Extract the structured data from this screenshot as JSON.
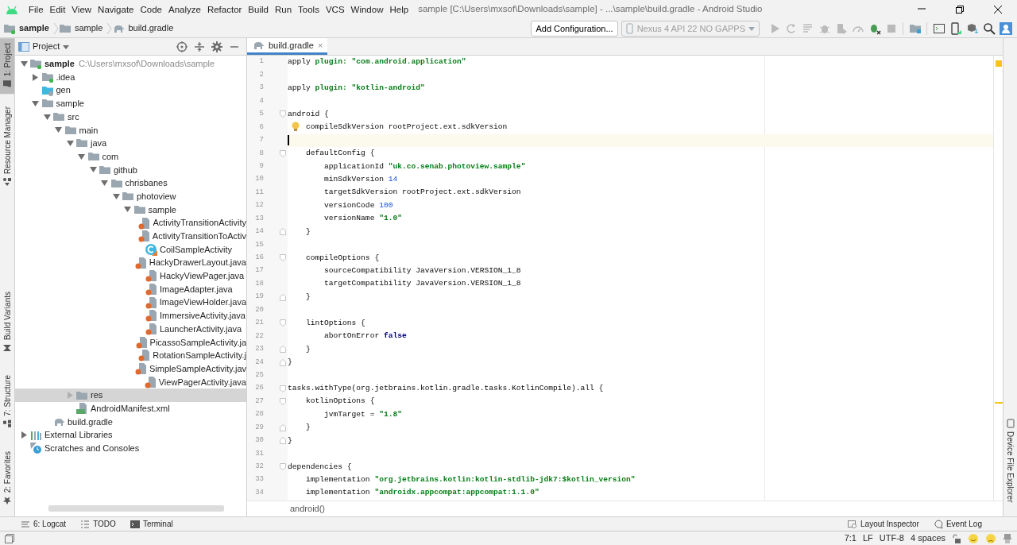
{
  "window": {
    "title": "sample [C:\\Users\\mxsof\\Downloads\\sample] - ...\\sample\\build.gradle - Android Studio"
  },
  "menu": [
    "File",
    "Edit",
    "View",
    "Navigate",
    "Code",
    "Analyze",
    "Refactor",
    "Build",
    "Run",
    "Tools",
    "VCS",
    "Window",
    "Help"
  ],
  "breadcrumbs": [
    {
      "label": "sample",
      "kind": "project"
    },
    {
      "label": "sample",
      "kind": "folder"
    },
    {
      "label": "build.gradle",
      "kind": "gradle"
    }
  ],
  "run_config": {
    "label": "Add Configuration..."
  },
  "device": {
    "label": "Nexus 4 API 22 NO GAPPS",
    "disabled": true
  },
  "toolbar_buttons": [
    {
      "kind": "run",
      "disabled": true
    },
    {
      "kind": "apply-changes",
      "disabled": true
    },
    {
      "kind": "apply-code",
      "disabled": true
    },
    {
      "kind": "debug",
      "disabled": true
    },
    {
      "kind": "profile",
      "disabled": true
    },
    {
      "kind": "attach",
      "disabled": true
    },
    {
      "kind": "sync",
      "disabled": false
    },
    {
      "kind": "stop",
      "disabled": true
    },
    {
      "kind": "project-structure",
      "disabled": false
    },
    {
      "kind": "avd",
      "disabled": false
    },
    {
      "kind": "device",
      "disabled": false
    },
    {
      "kind": "sdk",
      "disabled": false
    },
    {
      "kind": "search",
      "disabled": false
    },
    {
      "kind": "account",
      "disabled": false
    }
  ],
  "left_stripe": {
    "top": [
      {
        "label": "1: Project",
        "kind": "folder",
        "selected": true
      },
      {
        "label": "Resource Manager",
        "kind": "resources",
        "selected": false
      }
    ],
    "bottom": [
      {
        "label": "Build Variants",
        "kind": "variants",
        "selected": false
      },
      {
        "label": "7: Structure",
        "kind": "structure",
        "selected": false
      },
      {
        "label": "2: Favorites",
        "kind": "star",
        "selected": false
      }
    ]
  },
  "project_panel": {
    "view": "Project"
  },
  "tree": [
    {
      "label": "sample",
      "kind": "module-folder",
      "bold": true,
      "hint": "C:\\Users\\mxsof\\Downloads\\sample",
      "expanded": true,
      "selected": false,
      "children": [
        {
          "label": ".idea",
          "kind": "module-folder",
          "expanded": false,
          "selected": false
        },
        {
          "label": "gen",
          "kind": "generated-folder",
          "selected": false
        },
        {
          "label": "sample",
          "kind": "folder",
          "expanded": true,
          "selected": false,
          "children": [
            {
              "label": "src",
              "kind": "folder",
              "expanded": true,
              "selected": false,
              "children": [
                {
                  "label": "main",
                  "kind": "folder",
                  "expanded": true,
                  "selected": false,
                  "children": [
                    {
                      "label": "java",
                      "kind": "folder",
                      "expanded": true,
                      "selected": false,
                      "children": [
                        {
                          "label": "com",
                          "kind": "folder",
                          "expanded": true,
                          "selected": false,
                          "children": [
                            {
                              "label": "github",
                              "kind": "folder",
                              "expanded": true,
                              "selected": false,
                              "children": [
                                {
                                  "label": "chrisbanes",
                                  "kind": "folder",
                                  "expanded": true,
                                  "selected": false,
                                  "children": [
                                    {
                                      "label": "photoview",
                                      "kind": "folder",
                                      "expanded": true,
                                      "selected": false,
                                      "children": [
                                        {
                                          "label": "sample",
                                          "kind": "folder",
                                          "expanded": true,
                                          "selected": false,
                                          "children": [
                                            {
                                              "label": "ActivityTransitionActivity",
                                              "kind": "java",
                                              "selected": false
                                            },
                                            {
                                              "label": "ActivityTransitionToActiv",
                                              "kind": "java",
                                              "selected": false
                                            },
                                            {
                                              "label": "CoilSampleActivity",
                                              "kind": "kotlin-class",
                                              "selected": false
                                            },
                                            {
                                              "label": "HackyDrawerLayout.java",
                                              "kind": "java",
                                              "selected": false
                                            },
                                            {
                                              "label": "HackyViewPager.java",
                                              "kind": "java",
                                              "selected": false
                                            },
                                            {
                                              "label": "ImageAdapter.java",
                                              "kind": "java",
                                              "selected": false
                                            },
                                            {
                                              "label": "ImageViewHolder.java",
                                              "kind": "java",
                                              "selected": false
                                            },
                                            {
                                              "label": "ImmersiveActivity.java",
                                              "kind": "java",
                                              "selected": false
                                            },
                                            {
                                              "label": "LauncherActivity.java",
                                              "kind": "java",
                                              "selected": false
                                            },
                                            {
                                              "label": "PicassoSampleActivity.ja",
                                              "kind": "java",
                                              "selected": false
                                            },
                                            {
                                              "label": "RotationSampleActivity.j",
                                              "kind": "java",
                                              "selected": false
                                            },
                                            {
                                              "label": "SimpleSampleActivity.jav",
                                              "kind": "java",
                                              "selected": false
                                            },
                                            {
                                              "label": "ViewPagerActivity.java",
                                              "kind": "java",
                                              "selected": false
                                            }
                                          ]
                                        }
                                      ]
                                    }
                                  ]
                                }
                              ]
                            }
                          ]
                        }
                      ]
                    },
                    {
                      "label": "res",
                      "kind": "folder",
                      "expanded": false,
                      "selected": true
                    },
                    {
                      "label": "AndroidManifest.xml",
                      "kind": "manifest",
                      "selected": false
                    }
                  ]
                }
              ]
            },
            {
              "label": "build.gradle",
              "kind": "gradle",
              "selected": false
            }
          ]
        }
      ]
    },
    {
      "label": "External Libraries",
      "kind": "libraries",
      "expanded": false,
      "selected": false
    },
    {
      "label": "Scratches and Consoles",
      "kind": "scratches",
      "selected": false
    }
  ],
  "editor": {
    "tab": {
      "label": "build.gradle",
      "close": "×",
      "selected": true
    },
    "lines": [
      {
        "number": "1",
        "kind": "plain",
        "current": false,
        "tokens": [
          {
            "kind": "plain",
            "text": "apply "
          },
          {
            "kind": "keyword",
            "text": "plugin: "
          },
          {
            "kind": "string",
            "text": "\"com.android.application\""
          }
        ]
      },
      {
        "number": "2",
        "kind": "plain",
        "current": false
      },
      {
        "number": "3",
        "kind": "plain",
        "current": false,
        "tokens": [
          {
            "kind": "plain",
            "text": "apply "
          },
          {
            "kind": "keyword",
            "text": "plugin: "
          },
          {
            "kind": "string",
            "text": "\"kotlin-android\""
          }
        ]
      },
      {
        "number": "4",
        "kind": "plain",
        "current": false
      },
      {
        "number": "5",
        "kind": "fold-start",
        "current": false,
        "tokens": [
          {
            "kind": "plain",
            "text": "android {"
          }
        ]
      },
      {
        "number": "6",
        "kind": "bulb",
        "current": false,
        "tokens": [
          {
            "kind": "plain",
            "text": "    compileSdkVersion rootProject.ext.sdkVersion"
          }
        ]
      },
      {
        "number": "7",
        "kind": "plain",
        "current": true
      },
      {
        "number": "8",
        "kind": "fold-start",
        "current": false,
        "tokens": [
          {
            "kind": "plain",
            "text": "    defaultConfig {"
          }
        ]
      },
      {
        "number": "9",
        "kind": "plain",
        "current": false,
        "tokens": [
          {
            "kind": "plain",
            "text": "        applicationId "
          },
          {
            "kind": "string",
            "text": "\"uk.co.senab.photoview.sample\""
          }
        ]
      },
      {
        "number": "10",
        "kind": "plain",
        "current": false,
        "tokens": [
          {
            "kind": "plain",
            "text": "        minSdkVersion "
          },
          {
            "kind": "number",
            "text": "14"
          }
        ]
      },
      {
        "number": "11",
        "kind": "plain",
        "current": false,
        "tokens": [
          {
            "kind": "plain",
            "text": "        targetSdkVersion rootProject.ext.sdkVersion"
          }
        ]
      },
      {
        "number": "12",
        "kind": "plain",
        "current": false,
        "tokens": [
          {
            "kind": "plain",
            "text": "        versionCode "
          },
          {
            "kind": "number",
            "text": "100"
          }
        ]
      },
      {
        "number": "13",
        "kind": "plain",
        "current": false,
        "tokens": [
          {
            "kind": "plain",
            "text": "        versionName "
          },
          {
            "kind": "string",
            "text": "\"1.0\""
          }
        ]
      },
      {
        "number": "14",
        "kind": "fold-end",
        "current": false,
        "tokens": [
          {
            "kind": "plain",
            "text": "    }"
          }
        ]
      },
      {
        "number": "15",
        "kind": "plain",
        "current": false
      },
      {
        "number": "16",
        "kind": "fold-start",
        "current": false,
        "tokens": [
          {
            "kind": "plain",
            "text": "    compileOptions {"
          }
        ]
      },
      {
        "number": "17",
        "kind": "plain",
        "current": false,
        "tokens": [
          {
            "kind": "plain",
            "text": "        sourceCompatibility JavaVersion.VERSION_1_8"
          }
        ]
      },
      {
        "number": "18",
        "kind": "plain",
        "current": false,
        "tokens": [
          {
            "kind": "plain",
            "text": "        targetCompatibility JavaVersion.VERSION_1_8"
          }
        ]
      },
      {
        "number": "19",
        "kind": "fold-end",
        "current": false,
        "tokens": [
          {
            "kind": "plain",
            "text": "    }"
          }
        ]
      },
      {
        "number": "20",
        "kind": "plain",
        "current": false
      },
      {
        "number": "21",
        "kind": "fold-start",
        "current": false,
        "tokens": [
          {
            "kind": "plain",
            "text": "    lintOptions {"
          }
        ]
      },
      {
        "number": "22",
        "kind": "plain",
        "current": false,
        "tokens": [
          {
            "kind": "plain",
            "text": "        abortOnError "
          },
          {
            "kind": "literal",
            "text": "false"
          }
        ]
      },
      {
        "number": "23",
        "kind": "fold-end",
        "current": false,
        "tokens": [
          {
            "kind": "plain",
            "text": "    }"
          }
        ]
      },
      {
        "number": "24",
        "kind": "fold-end",
        "current": false,
        "tokens": [
          {
            "kind": "plain",
            "text": "}"
          }
        ]
      },
      {
        "number": "25",
        "kind": "plain",
        "current": false
      },
      {
        "number": "26",
        "kind": "fold-start",
        "current": false,
        "tokens": [
          {
            "kind": "plain",
            "text": "tasks.withType(org.jetbrains.kotlin.gradle.tasks.KotlinCompile).all {"
          }
        ]
      },
      {
        "number": "27",
        "kind": "fold-start",
        "current": false,
        "tokens": [
          {
            "kind": "plain",
            "text": "    kotlinOptions {"
          }
        ]
      },
      {
        "number": "28",
        "kind": "plain",
        "current": false,
        "tokens": [
          {
            "kind": "plain",
            "text": "        jvmTarget = "
          },
          {
            "kind": "string",
            "text": "\"1.8\""
          }
        ]
      },
      {
        "number": "29",
        "kind": "fold-end",
        "current": false,
        "tokens": [
          {
            "kind": "plain",
            "text": "    }"
          }
        ]
      },
      {
        "number": "30",
        "kind": "fold-end",
        "current": false,
        "tokens": [
          {
            "kind": "plain",
            "text": "}"
          }
        ]
      },
      {
        "number": "31",
        "kind": "plain",
        "current": false
      },
      {
        "number": "32",
        "kind": "fold-start",
        "current": false,
        "tokens": [
          {
            "kind": "plain",
            "text": "dependencies {"
          }
        ]
      },
      {
        "number": "33",
        "kind": "plain",
        "current": false,
        "tokens": [
          {
            "kind": "plain",
            "text": "    implementation "
          },
          {
            "kind": "string",
            "text": "\"org.jetbrains.kotlin:kotlin-stdlib-jdk7:$kotlin_version\""
          }
        ]
      },
      {
        "number": "34",
        "kind": "plain",
        "current": false,
        "tokens": [
          {
            "kind": "plain",
            "text": "    implementation "
          },
          {
            "kind": "string",
            "text": "\"androidx.appcompat:appcompat:1.1.0\""
          }
        ]
      }
    ],
    "breadcrumb": "android()"
  },
  "right_stripe": [
    {
      "label": "Device File Explorer",
      "kind": "device",
      "selected": false
    }
  ],
  "bottom_tools": {
    "left": [
      {
        "label": "6: Logcat",
        "kind": "logcat"
      },
      {
        "label": "TODO",
        "kind": "todo"
      },
      {
        "label": "Terminal",
        "kind": "terminal"
      }
    ],
    "right": [
      {
        "label": "Layout Inspector",
        "kind": "inspector"
      },
      {
        "label": "Event Log",
        "kind": "log"
      }
    ]
  },
  "status_bar": {
    "items": [
      "7:1",
      "LF",
      "UTF-8",
      "4 spaces"
    ]
  }
}
